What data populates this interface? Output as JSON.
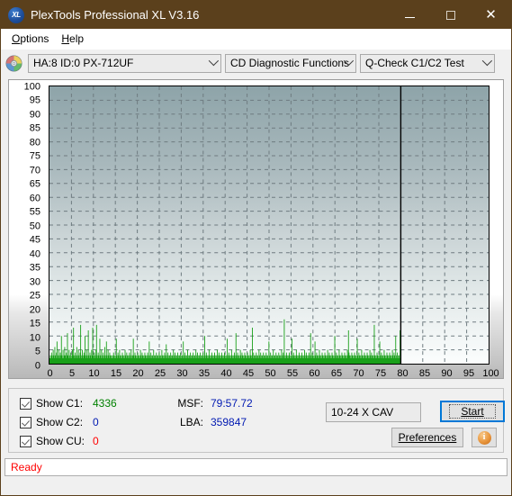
{
  "window": {
    "title": "PlexTools Professional XL V3.16",
    "app_icon": "xl-disc-icon",
    "icon_text": "XL",
    "titlebar_color": "#5b401c",
    "minimize_label": "Minimize",
    "maximize_label": "Maximize",
    "close_label": "Close"
  },
  "menubar": {
    "items": [
      {
        "label": "Options",
        "accel": "O"
      },
      {
        "label": "Help",
        "accel": "H"
      }
    ]
  },
  "toolbar": {
    "disc_icon": "cd-disc-icon",
    "device_select": "HA:8 ID:0  PX-712UF",
    "function_select": "CD Diagnostic Functions",
    "test_select": "Q-Check C1/C2 Test"
  },
  "chart_data": {
    "type": "bar",
    "title": "",
    "xlabel": "",
    "ylabel": "",
    "xlim": [
      0,
      100
    ],
    "ylim": [
      0,
      100
    ],
    "grid": true,
    "legend_position": "none",
    "series_color": "#19a019",
    "background_top_color": "#8ea4a9",
    "background_bottom_color": "#fbfdfd",
    "x_ticks": [
      0,
      5,
      10,
      15,
      20,
      25,
      30,
      35,
      40,
      45,
      50,
      55,
      60,
      65,
      70,
      75,
      80,
      85,
      90,
      95,
      100
    ],
    "y_ticks": [
      0,
      5,
      10,
      15,
      20,
      25,
      30,
      35,
      40,
      45,
      50,
      55,
      60,
      65,
      70,
      75,
      80,
      85,
      90,
      95,
      100
    ],
    "data_end_marker_x": 80,
    "series": [
      {
        "name": "C1",
        "color": "#19a019",
        "x_start": 0,
        "x_end": 80,
        "values": [
          2,
          3,
          2,
          4,
          3,
          2,
          5,
          3,
          2,
          6,
          3,
          2,
          4,
          8,
          3,
          2,
          5,
          3,
          2,
          4,
          3,
          10,
          3,
          2,
          5,
          2,
          3,
          6,
          3,
          2,
          4,
          3,
          11,
          3,
          2,
          5,
          3,
          2,
          4,
          3,
          2,
          5,
          3,
          13,
          3,
          2,
          4,
          3,
          2,
          6,
          3,
          2,
          5,
          3,
          2,
          4,
          14,
          3,
          2,
          5,
          3,
          2,
          4,
          3,
          10,
          3,
          2,
          5,
          3,
          2,
          12,
          3,
          2,
          4,
          3,
          2,
          5,
          3,
          13,
          3,
          2,
          4,
          3,
          2,
          5,
          14,
          3,
          2,
          4,
          3,
          2,
          9,
          3,
          2,
          5,
          3,
          2,
          4,
          3,
          2,
          6,
          3,
          2,
          8,
          3,
          2,
          5,
          3,
          2,
          4,
          3,
          2,
          3,
          2,
          3,
          2,
          4,
          3,
          2,
          3,
          2,
          9,
          3,
          2,
          4,
          3,
          2,
          5,
          3,
          2,
          3,
          2,
          4,
          3,
          2,
          3,
          2,
          5,
          3,
          2,
          4,
          3,
          2,
          3,
          2,
          4,
          3,
          2,
          5,
          3,
          2,
          3,
          9,
          3,
          2,
          4,
          3,
          2,
          3,
          2,
          4,
          3,
          2,
          3,
          2,
          5,
          3,
          2,
          4,
          3,
          2,
          3,
          2,
          4,
          3,
          2,
          3,
          2,
          4,
          3,
          2,
          8,
          3,
          2,
          4,
          3,
          2,
          3,
          2,
          5,
          3,
          2,
          3,
          2,
          4,
          3,
          2,
          3,
          2,
          4,
          3,
          2,
          3,
          2,
          5,
          3,
          2,
          3,
          2,
          4,
          3,
          2,
          7,
          3,
          2,
          4,
          3,
          2,
          3,
          2,
          4,
          3,
          2,
          3,
          2,
          5,
          3,
          2,
          4,
          3,
          2,
          3,
          2,
          4,
          3,
          2,
          3,
          2,
          4,
          3,
          2,
          3,
          2,
          8,
          3,
          2,
          4,
          3,
          2,
          3,
          2,
          5,
          3,
          2,
          3,
          2,
          4,
          3,
          2,
          3,
          2,
          4,
          3,
          2,
          3,
          2,
          5,
          3,
          2,
          4,
          3,
          2,
          3,
          2,
          4,
          3,
          2,
          3,
          2,
          4,
          3,
          2,
          10,
          3,
          2,
          4,
          3,
          2,
          3,
          2,
          5,
          3,
          2,
          3,
          2,
          4,
          3,
          2,
          3,
          2,
          4,
          3,
          2,
          3,
          2,
          5,
          3,
          2,
          4,
          3,
          2,
          3,
          2,
          4,
          3,
          2,
          3,
          2,
          4,
          3,
          2,
          3,
          2,
          9,
          3,
          2,
          4,
          3,
          2,
          3,
          2,
          5,
          3,
          2,
          3,
          2,
          4,
          3,
          2,
          11,
          3,
          2,
          4,
          3,
          2,
          3,
          2,
          5,
          3,
          2,
          4,
          3,
          2,
          3,
          2,
          4,
          3,
          2,
          3,
          2,
          4,
          3,
          2,
          3,
          2,
          5,
          3,
          2,
          3,
          13,
          2,
          4,
          3,
          2,
          3,
          2,
          4,
          3,
          2,
          3,
          2,
          5,
          3,
          2,
          4,
          3,
          2,
          3,
          2,
          4,
          3,
          2,
          3,
          2,
          4,
          3,
          2,
          3,
          2,
          8,
          3,
          2,
          4,
          3,
          2,
          3,
          2,
          5,
          3,
          2,
          3,
          2,
          4,
          3,
          2,
          3,
          2,
          4,
          3,
          2,
          3,
          2,
          5,
          3,
          2,
          4,
          3,
          16,
          2,
          3,
          2,
          4,
          3,
          2,
          3,
          2,
          4,
          3,
          2,
          3,
          2,
          9,
          3,
          2,
          4,
          3,
          2,
          3,
          2,
          5,
          3,
          2,
          3,
          2,
          4,
          3,
          2,
          3,
          2,
          4,
          3,
          2,
          3,
          2,
          5,
          3,
          2,
          4,
          3,
          2,
          3,
          2,
          4,
          3,
          2,
          11,
          3,
          2,
          4,
          3,
          2,
          3,
          2,
          8,
          3,
          2,
          4,
          3,
          2,
          3,
          2,
          5,
          3,
          2,
          3,
          2,
          4,
          3,
          2,
          3,
          2,
          4,
          3,
          2,
          3,
          2,
          5,
          3,
          2,
          4,
          3,
          2,
          3,
          2,
          4,
          3,
          2,
          3,
          2,
          10,
          3,
          2,
          4,
          3,
          2,
          3,
          2,
          5,
          3,
          2,
          3,
          2,
          4,
          3,
          2,
          3,
          2,
          4,
          3,
          2,
          3,
          2,
          5,
          3,
          12,
          4,
          3,
          2,
          3,
          2,
          4,
          3,
          2,
          3,
          2,
          4,
          3,
          2,
          3,
          2,
          9,
          3,
          2,
          4,
          3,
          2,
          3,
          2,
          5,
          3,
          2,
          3,
          2,
          4,
          3,
          2,
          3,
          2,
          4,
          3,
          2,
          3,
          2,
          5,
          3,
          2,
          4,
          3,
          2,
          3,
          2,
          14,
          3,
          2,
          3,
          2,
          4,
          3,
          2,
          3,
          2,
          8,
          3,
          2,
          4,
          3,
          2,
          3,
          2,
          5,
          3,
          2,
          3,
          2,
          4,
          3,
          2,
          3,
          2,
          4,
          3,
          2,
          3,
          2,
          5,
          3,
          2,
          4,
          3,
          2,
          10,
          3,
          2,
          4,
          3,
          2,
          3,
          2,
          12,
          3
        ]
      }
    ]
  },
  "stats": {
    "checkboxes": [
      {
        "label": "Show C1:",
        "value": "4336",
        "color": "#008000",
        "checked": true
      },
      {
        "label": "Show C2:",
        "value": "0",
        "color": "#0019b2",
        "checked": true
      },
      {
        "label": "Show CU:",
        "value": "0",
        "color": "#ff0000",
        "checked": true
      }
    ],
    "msf_label": "MSF:",
    "msf_value": "79:57.72",
    "lba_label": "LBA:",
    "lba_value": "359847",
    "speed_select": "10-24 X CAV",
    "start_label": "Start",
    "preferences_label": "Preferences",
    "info_label": "i"
  },
  "statusbar": {
    "text": "Ready",
    "color": "#ff0000"
  }
}
